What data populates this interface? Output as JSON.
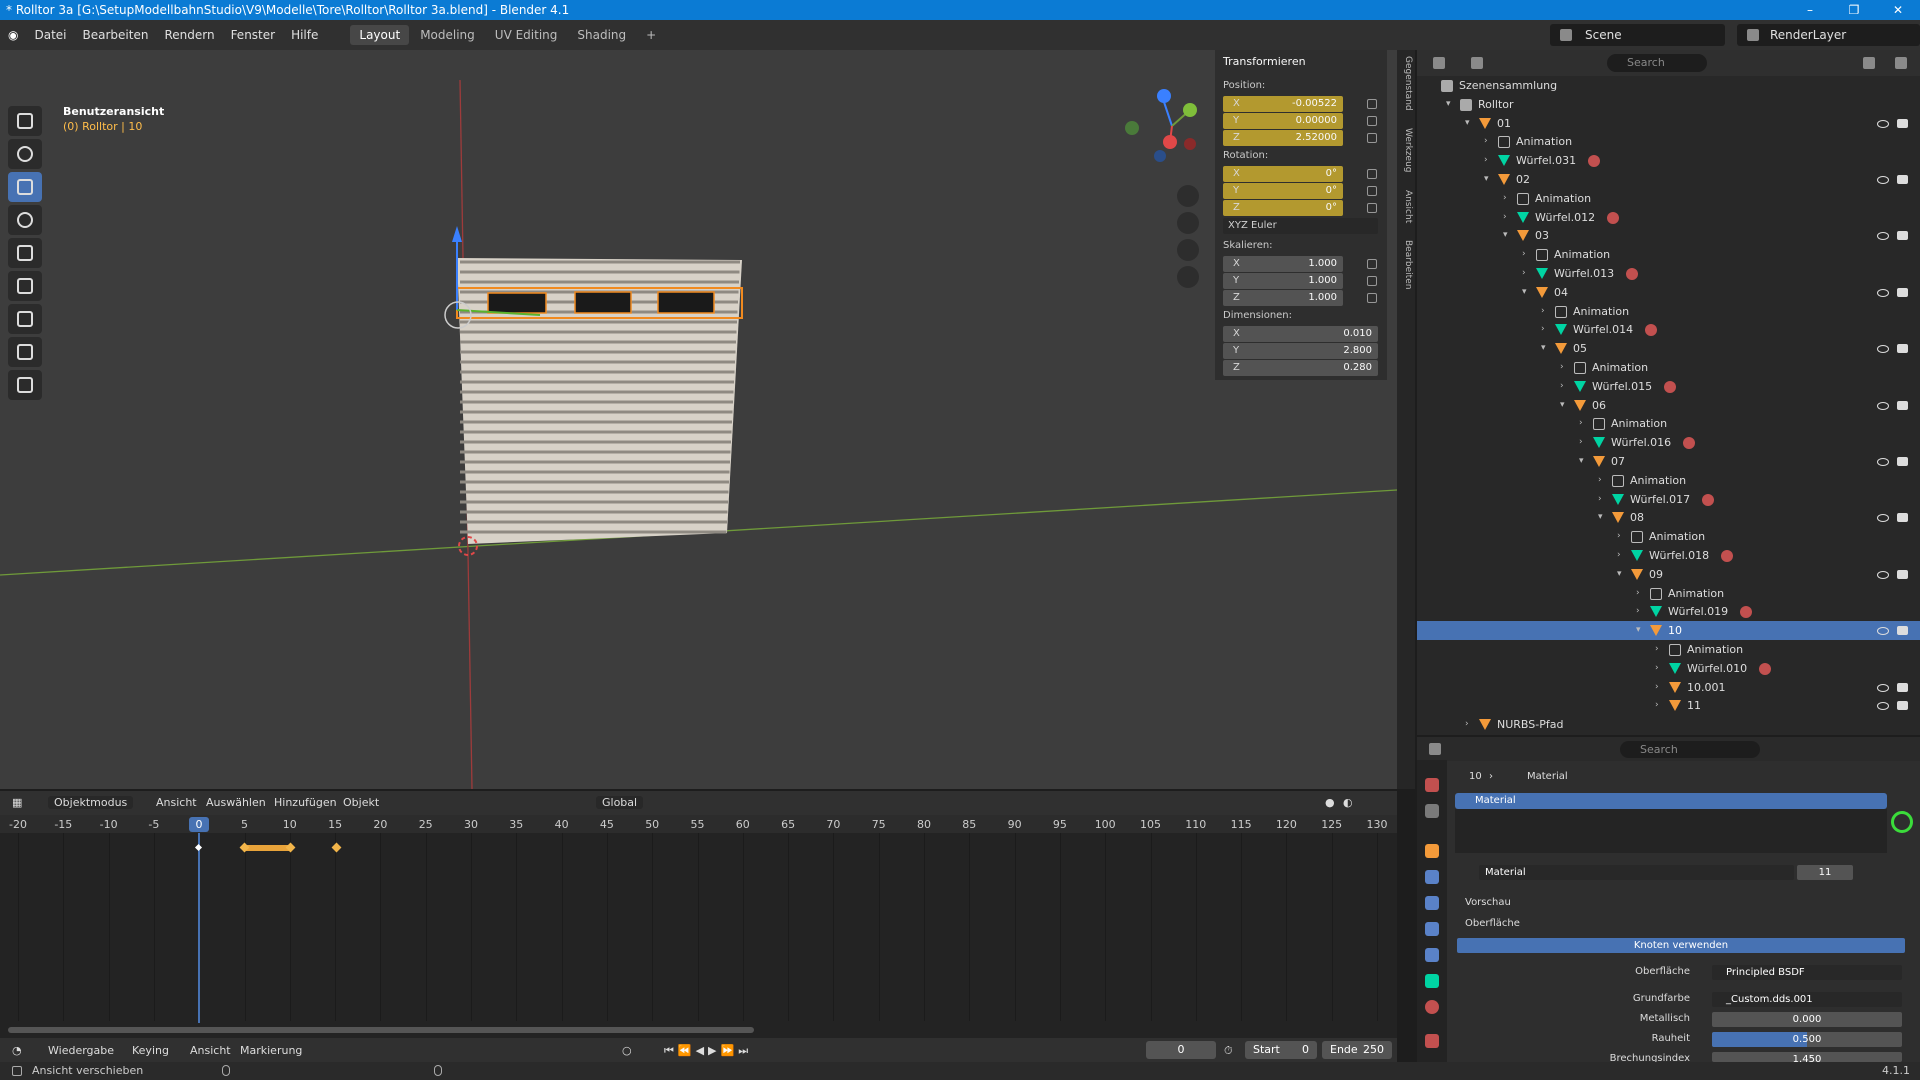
{
  "window": {
    "title": "* Rolltor 3a [G:\\SetupModellbahnStudio\\V9\\Modelle\\Tore\\Rolltor\\Rolltor 3a.blend] - Blender 4.1",
    "min": "–",
    "max": "❐",
    "close": "✕"
  },
  "menu": [
    "Datei",
    "Bearbeiten",
    "Rendern",
    "Fenster",
    "Hilfe"
  ],
  "workspaces": [
    "Layout",
    "Modeling",
    "UV Editing",
    "Shading",
    "+"
  ],
  "scene": "Scene",
  "render_layer": "RenderLayer",
  "viewport": {
    "title": "Benutzeransicht",
    "subtitle": "(0) Rolltor | 10"
  },
  "npanel": {
    "header": "Transformieren",
    "position_label": "Position:",
    "position": [
      {
        "ax": "X",
        "v": "-0.00522"
      },
      {
        "ax": "Y",
        "v": "0.00000"
      },
      {
        "ax": "Z",
        "v": "2.52000"
      }
    ],
    "rotation_label": "Rotation:",
    "rotation": [
      {
        "ax": "X",
        "v": "0°"
      },
      {
        "ax": "Y",
        "v": "0°"
      },
      {
        "ax": "Z",
        "v": "0°"
      }
    ],
    "euler": "XYZ Euler",
    "scale_label": "Skalieren:",
    "scale": [
      {
        "ax": "X",
        "v": "1.000"
      },
      {
        "ax": "Y",
        "v": "1.000"
      },
      {
        "ax": "Z",
        "v": "1.000"
      }
    ],
    "dim_label": "Dimensionen:",
    "dimensions": [
      {
        "ax": "X",
        "v": "0.010"
      },
      {
        "ax": "Y",
        "v": "2.800"
      },
      {
        "ax": "Z",
        "v": "0.280"
      }
    ]
  },
  "sidetabs": [
    "Gegenstand",
    "Werkzeug",
    "Ansicht",
    "Bearbeiten"
  ],
  "outliner": {
    "search_placeholder": "Search",
    "rows": [
      {
        "label": "Szenensammlung",
        "ind": 0,
        "icon": "scn"
      },
      {
        "label": "Rolltor",
        "ind": 1,
        "icon": "scn",
        "arrow": "▾"
      },
      {
        "label": "01",
        "ind": 2,
        "icon": "empty",
        "arrow": "▾",
        "vis": true
      },
      {
        "label": "Animation",
        "ind": 3,
        "icon": "anim",
        "arrow": "›"
      },
      {
        "label": "Würfel.031",
        "ind": 3,
        "icon": "mesh",
        "arrow": "›"
      },
      {
        "label": "02",
        "ind": 3,
        "icon": "empty",
        "arrow": "▾",
        "vis": true
      },
      {
        "label": "Animation",
        "ind": 4,
        "icon": "anim",
        "arrow": "›"
      },
      {
        "label": "Würfel.012",
        "ind": 4,
        "icon": "mesh",
        "arrow": "›"
      },
      {
        "label": "03",
        "ind": 4,
        "icon": "empty",
        "arrow": "▾",
        "vis": true
      },
      {
        "label": "Animation",
        "ind": 5,
        "icon": "anim",
        "arrow": "›"
      },
      {
        "label": "Würfel.013",
        "ind": 5,
        "icon": "mesh",
        "arrow": "›"
      },
      {
        "label": "04",
        "ind": 5,
        "icon": "empty",
        "arrow": "▾",
        "vis": true
      },
      {
        "label": "Animation",
        "ind": 6,
        "icon": "anim",
        "arrow": "›"
      },
      {
        "label": "Würfel.014",
        "ind": 6,
        "icon": "mesh",
        "arrow": "›"
      },
      {
        "label": "05",
        "ind": 6,
        "icon": "empty",
        "arrow": "▾",
        "vis": true
      },
      {
        "label": "Animation",
        "ind": 7,
        "icon": "anim",
        "arrow": "›"
      },
      {
        "label": "Würfel.015",
        "ind": 7,
        "icon": "mesh",
        "arrow": "›"
      },
      {
        "label": "06",
        "ind": 7,
        "icon": "empty",
        "arrow": "▾",
        "vis": true
      },
      {
        "label": "Animation",
        "ind": 8,
        "icon": "anim",
        "arrow": "›"
      },
      {
        "label": "Würfel.016",
        "ind": 8,
        "icon": "mesh",
        "arrow": "›"
      },
      {
        "label": "07",
        "ind": 8,
        "icon": "empty",
        "arrow": "▾",
        "vis": true
      },
      {
        "label": "Animation",
        "ind": 9,
        "icon": "anim",
        "arrow": "›"
      },
      {
        "label": "Würfel.017",
        "ind": 9,
        "icon": "mesh",
        "arrow": "›"
      },
      {
        "label": "08",
        "ind": 9,
        "icon": "empty",
        "arrow": "▾",
        "vis": true
      },
      {
        "label": "Animation",
        "ind": 10,
        "icon": "anim",
        "arrow": "›"
      },
      {
        "label": "Würfel.018",
        "ind": 10,
        "icon": "mesh",
        "arrow": "›"
      },
      {
        "label": "09",
        "ind": 10,
        "icon": "empty",
        "arrow": "▾",
        "vis": true
      },
      {
        "label": "Animation",
        "ind": 11,
        "icon": "anim",
        "arrow": "›"
      },
      {
        "label": "Würfel.019",
        "ind": 11,
        "icon": "mesh",
        "arrow": "›"
      },
      {
        "label": "10",
        "ind": 11,
        "icon": "empty",
        "arrow": "▾",
        "vis": true,
        "sel": true
      },
      {
        "label": "Animation",
        "ind": 12,
        "icon": "anim",
        "arrow": "›"
      },
      {
        "label": "Würfel.010",
        "ind": 12,
        "icon": "mesh",
        "arrow": "›"
      },
      {
        "label": "10.001",
        "ind": 12,
        "icon": "empty",
        "arrow": "›",
        "vis": true
      },
      {
        "label": "11",
        "ind": 12,
        "icon": "empty",
        "arrow": "›",
        "vis": true
      },
      {
        "label": "NURBS-Pfad",
        "ind": 2,
        "icon": "empty",
        "arrow": "›"
      }
    ]
  },
  "properties": {
    "search_placeholder": "Search",
    "breadcrumb_obj": "10",
    "breadcrumb_sep": "›",
    "breadcrumb_mat": "Material",
    "slot": "Material",
    "material_name": "Material",
    "users": "11",
    "preview": "Vorschau",
    "surface_section": "Oberfläche",
    "use_nodes": "Knoten verwenden",
    "surface_label": "Oberfläche",
    "surface_value": "Principled BSDF",
    "base_color_label": "Grundfarbe",
    "base_color_value": "_Custom.dds.001",
    "metallic_label": "Metallisch",
    "metallic_value": "0.000",
    "roughness_label": "Rauheit",
    "roughness_value": "0.500",
    "roughness": 0.5,
    "ior_label": "Brechungsindex",
    "ior_value": "1.450"
  },
  "timeline": {
    "mode": "Objektmodus",
    "menus": [
      "Ansicht",
      "Auswählen",
      "Hinzufügen",
      "Objekt"
    ],
    "orientation": "Global",
    "ticks": [
      "-20",
      "-15",
      "-10",
      "-5",
      "0",
      "5",
      "10",
      "15",
      "20",
      "25",
      "30",
      "35",
      "40",
      "45",
      "50",
      "55",
      "60",
      "65",
      "70",
      "75",
      "80",
      "85",
      "90",
      "95",
      "100",
      "105",
      "110",
      "115",
      "120",
      "125",
      "130"
    ],
    "current": "0",
    "bottom_menus": [
      "Wiedergabe",
      "Keying",
      "Ansicht",
      "Markierung"
    ],
    "frame": "0",
    "start_label": "Start",
    "start": "0",
    "end_label": "Ende",
    "end": "250"
  },
  "status": {
    "left": "Ansicht verschieben",
    "version": "4.1.1"
  }
}
